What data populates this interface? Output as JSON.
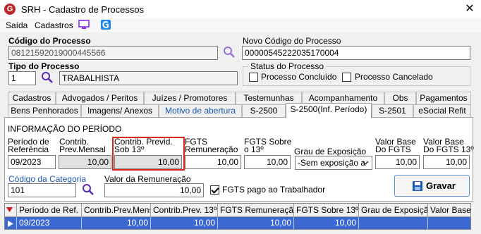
{
  "window": {
    "title": "SRH - Cadastro de Processos",
    "logo_letter": "G"
  },
  "menu": {
    "items": [
      "Saída",
      "Cadastros"
    ]
  },
  "processo": {
    "codigo_label": "Código do Processo",
    "codigo_value": "08121592019000445566",
    "novo_codigo_label": "Novo Código do Processo",
    "novo_codigo_value": "00000545222035170004",
    "tipo_label": "Tipo do Processo",
    "tipo_code": "1",
    "tipo_desc": "TRABALHISTA"
  },
  "status": {
    "title": "Status do Processo",
    "concluido_label": "Processo Concluído",
    "cancelado_label": "Processo Cancelado"
  },
  "tabs_row1": [
    "Cadastros",
    "Advogados / Peritos",
    "Juízes / Promotores",
    "Testemunhas",
    "Acompanhamento",
    "Obs",
    "Pagamentos"
  ],
  "tabs_row2": [
    "Bens Penhorados",
    "Imagens/ Anexos",
    "Motivo de abertura",
    "S-2500",
    "S-2500(Inf. Período)",
    "S-2501",
    "eSocial Refit"
  ],
  "periodo": {
    "section_title": "INFORMAÇÃO DO PERÍODO",
    "ref_label_1": "Período de",
    "ref_label_2": "Referência",
    "ref_value": "09/2023",
    "cpm_label_1": "Contrib.",
    "cpm_label_2": "Prev.Mensal",
    "cpm_value": "10,00",
    "cp13_label_1": "Contrib. Previd.",
    "cp13_label_2": "Sob 13º",
    "cp13_value": "10,00",
    "fgts_label_1": "FGTS",
    "fgts_label_2": "Remuneração",
    "fgts_value": "10,00",
    "fgts13_label_1": "FGTS Sobre",
    "fgts13_label_2": "o 13º",
    "fgts13_value": "10,00",
    "grau_label": "Grau de Exposição",
    "grau_value": "-Sem exposição a",
    "vb_label_1": "Valor Base",
    "vb_label_2": "Do FGTS",
    "vb_value": "10,00",
    "vb13_label_1": "Valor Base",
    "vb13_label_2": "Do FGTS 13º",
    "vb13_value": "10,00",
    "categoria_label": "Código da Categoria",
    "categoria_value": "101",
    "remun_label": "Valor da Remuneração",
    "remun_value": "10,00",
    "fgts_pago_label": "FGTS pago ao Trabalhador",
    "fgts_pago_checked": true,
    "gravar_label": "Gravar"
  },
  "grid": {
    "headers": [
      "Período de Ref.",
      "Contrib.Prev.Mensal",
      "Contrib.Prev. 13º",
      "FGTS Remuneração",
      "FGTS Sobre 13º",
      "Grau de Exposição",
      "Valor Base"
    ],
    "row": [
      "09/2023",
      "10,00",
      "10,00",
      "10,00",
      "10,00",
      "",
      ""
    ]
  },
  "colors": {
    "selected_row": "#3b68d1",
    "highlight": "#e0221f",
    "tab_blue": "#1a55b0"
  }
}
